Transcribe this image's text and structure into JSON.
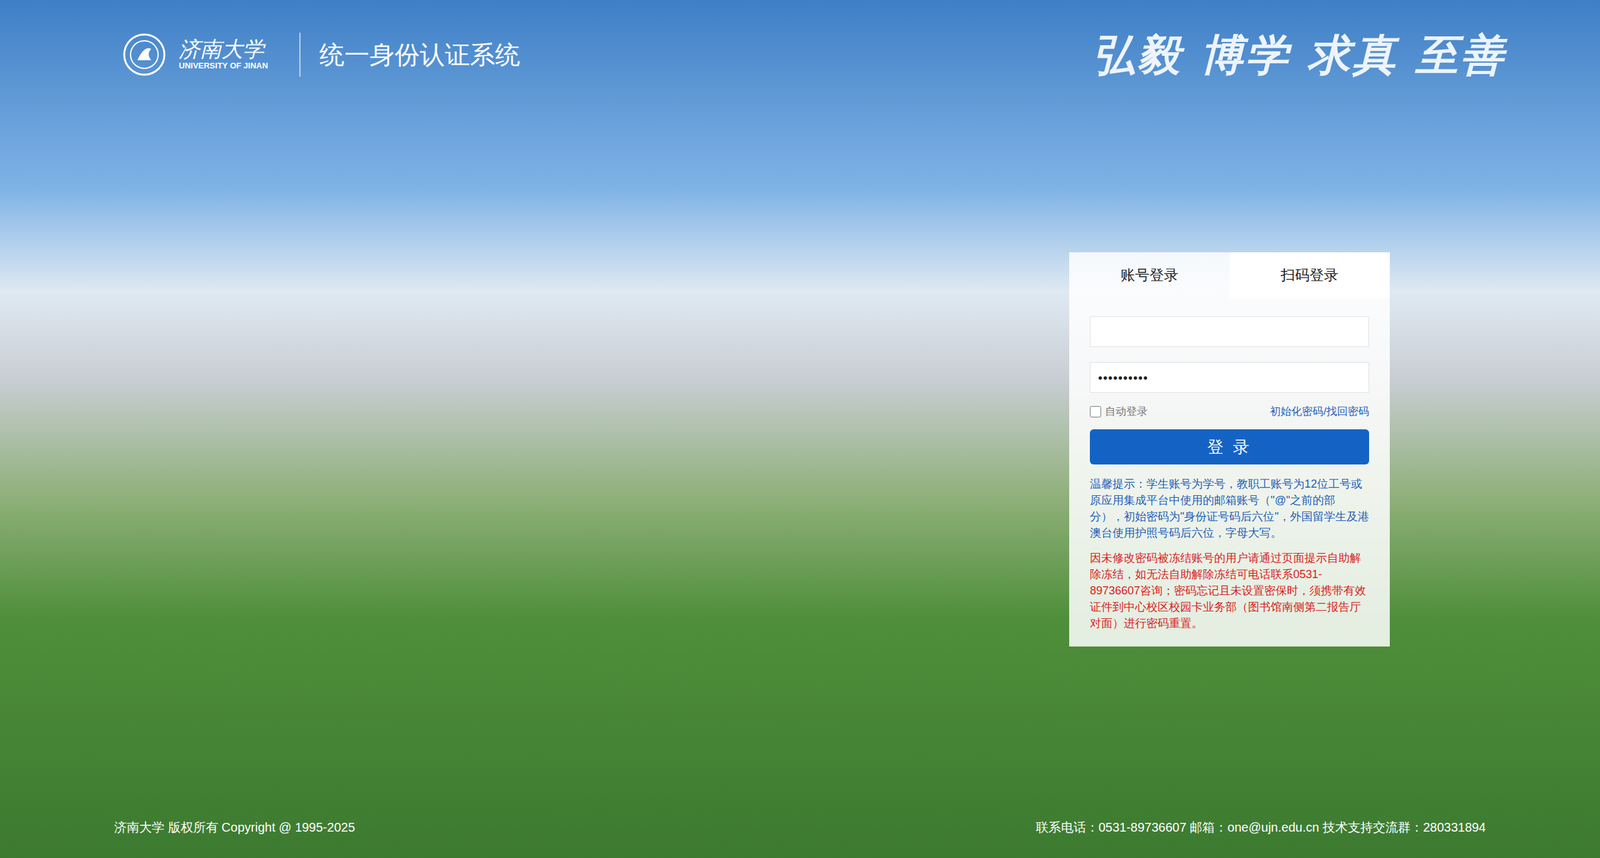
{
  "header": {
    "logo_cn": "济南大学",
    "logo_en": "UNIVERSITY OF JINAN",
    "system_title": "统一身份认证系统",
    "motto": "弘毅 博学 求真 至善"
  },
  "login_panel": {
    "tabs": [
      {
        "label": "账号登录",
        "selected": true
      },
      {
        "label": "扫码登录",
        "selected": false
      }
    ],
    "username": {
      "value": ""
    },
    "password": {
      "value": "••••••••••"
    },
    "auto_login": {
      "label": "自动登录",
      "checked": false
    },
    "reset_link": "初始化密码/找回密码",
    "login_button": "登 录",
    "tip": "温馨提示：学生账号为学号，教职工账号为12位工号或原应用集成平台中使用的邮箱账号（\"@\"之前的部分），初始密码为\"身份证号码后六位\"，外国留学生及港澳台使用护照号码后六位，字母大写。",
    "warning": "因未修改密码被冻结账号的用户请通过页面提示自助解除冻结，如无法自助解除冻结可电话联系0531-89736607咨询；密码忘记且未设置密保时，须携带有效证件到中心校区校园卡业务部（图书馆南侧第二报告厅对面）进行密码重置。"
  },
  "footer": {
    "copyright": "济南大学 版权所有 Copyright @ 1995-2025",
    "contact": "联系电话：0531-89736607 邮箱：one@ujn.edu.cn 技术支持交流群：280331894"
  }
}
